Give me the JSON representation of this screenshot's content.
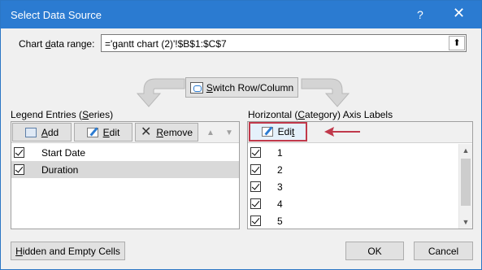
{
  "window": {
    "title": "Select Data Source",
    "help_glyph": "?",
    "close_glyph": "✕"
  },
  "range": {
    "label_pre": "Chart ",
    "label_u": "d",
    "label_post": "ata range:",
    "value": "='gantt chart (2)'!$B$1:$C$7",
    "collapse_glyph": "⬆"
  },
  "switch": {
    "label_u": "S",
    "label_post": "witch Row/Column"
  },
  "legend": {
    "title_pre": "Legend Entries (",
    "title_u": "S",
    "title_post": "eries)",
    "add_u": "A",
    "add_post": "dd",
    "edit_u": "E",
    "edit_post": "dit",
    "remove_u": "R",
    "remove_post": "emove",
    "up_glyph": "▲",
    "down_glyph": "▼",
    "items": [
      {
        "label": "Start Date",
        "checked": true,
        "selected": false
      },
      {
        "label": "Duration",
        "checked": true,
        "selected": true
      }
    ]
  },
  "axis": {
    "title_pre": "Horizontal (",
    "title_u": "C",
    "title_post": "ategory) Axis Labels",
    "edit_pre": "Edi",
    "edit_u": "t",
    "items": [
      "1",
      "2",
      "3",
      "4",
      "5"
    ],
    "scroll_up": "▲",
    "scroll_down": "▼"
  },
  "footer": {
    "hidden_u": "H",
    "hidden_post": "idden and Empty Cells",
    "ok": "OK",
    "cancel": "Cancel"
  },
  "colors": {
    "titlebar": "#2b7bd1",
    "annotation_arrow": "#c0394b"
  }
}
